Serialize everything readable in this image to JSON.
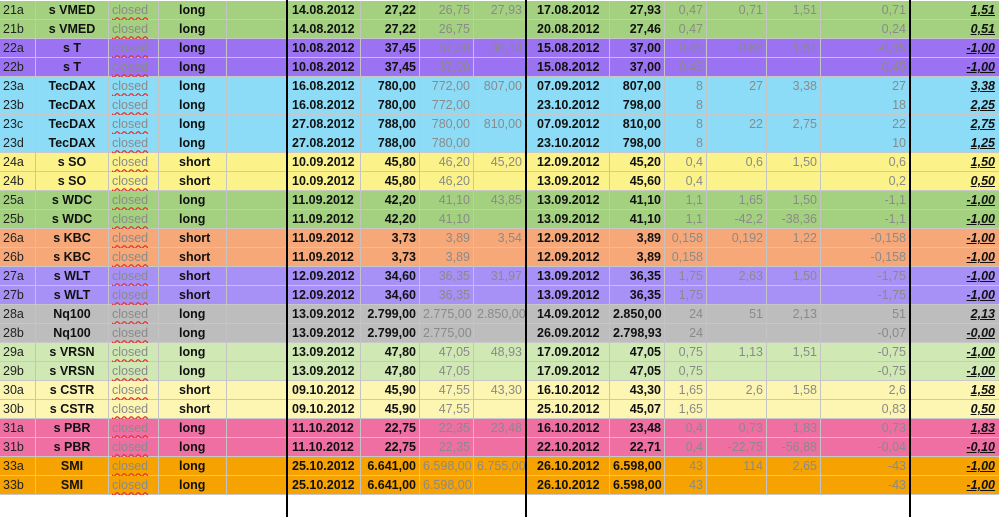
{
  "columns": [
    "id",
    "symbol",
    "status",
    "direction",
    "blank",
    "entry_date",
    "entry_price",
    "stop",
    "target",
    "exit_date",
    "exit_price",
    "risk",
    "reward",
    "crv",
    "result",
    "r_multiple"
  ],
  "rows": [
    {
      "id": "21a",
      "symbol": "s VMED",
      "status": "closed",
      "direction": "long",
      "entry_date": "14.08.2012",
      "entry_price": "27,22",
      "stop": "26,75",
      "target": "27,93",
      "exit_date": "17.08.2012",
      "exit_price": "27,93",
      "risk": "0,47",
      "reward": "0,71",
      "crv": "1,51",
      "result": "0,71",
      "r_multiple": "1,51",
      "color": "#a4d17f"
    },
    {
      "id": "21b",
      "symbol": "s VMED",
      "status": "closed",
      "direction": "long",
      "entry_date": "14.08.2012",
      "entry_price": "27,22",
      "stop": "26,75",
      "target": "",
      "exit_date": "20.08.2012",
      "exit_price": "27,46",
      "risk": "0,47",
      "reward": "",
      "crv": "",
      "result": "0,24",
      "r_multiple": "0,51",
      "color": "#a4d17f"
    },
    {
      "id": "22a",
      "symbol": "s T",
      "status": "closed",
      "direction": "long",
      "entry_date": "10.08.2012",
      "entry_price": "37,45",
      "stop": "37,00",
      "target": "38,13",
      "exit_date": "15.08.2012",
      "exit_price": "37,00",
      "risk": "0,45",
      "reward": "0,68",
      "crv": "1,51",
      "result": "-0,45",
      "r_multiple": "-1,00",
      "color": "#9b72f2"
    },
    {
      "id": "22b",
      "symbol": "s T",
      "status": "closed",
      "direction": "long",
      "entry_date": "10.08.2012",
      "entry_price": "37,45",
      "stop": "37,00",
      "target": "",
      "exit_date": "15.08.2012",
      "exit_price": "37,00",
      "risk": "0,45",
      "reward": "",
      "crv": "",
      "result": "-0,45",
      "r_multiple": "-1,00",
      "color": "#9b72f2"
    },
    {
      "id": "23a",
      "symbol": "TecDAX",
      "status": "closed",
      "direction": "long",
      "entry_date": "16.08.2012",
      "entry_price": "780,00",
      "stop": "772,00",
      "target": "807,00",
      "exit_date": "07.09.2012",
      "exit_price": "807,00",
      "risk": "8",
      "reward": "27",
      "crv": "3,38",
      "result": "27",
      "r_multiple": "3,38",
      "color": "#8ddcf7"
    },
    {
      "id": "23b",
      "symbol": "TecDAX",
      "status": "closed",
      "direction": "long",
      "entry_date": "16.08.2012",
      "entry_price": "780,00",
      "stop": "772,00",
      "target": "",
      "exit_date": "23.10.2012",
      "exit_price": "798,00",
      "risk": "8",
      "reward": "",
      "crv": "",
      "result": "18",
      "r_multiple": "2,25",
      "color": "#8ddcf7"
    },
    {
      "id": "23c",
      "symbol": "TecDAX",
      "status": "closed",
      "direction": "long",
      "entry_date": "27.08.2012",
      "entry_price": "788,00",
      "stop": "780,00",
      "target": "810,00",
      "exit_date": "07.09.2012",
      "exit_price": "810,00",
      "risk": "8",
      "reward": "22",
      "crv": "2,75",
      "result": "22",
      "r_multiple": "2,75",
      "color": "#8ddcf7"
    },
    {
      "id": "23d",
      "symbol": "TecDAX",
      "status": "closed",
      "direction": "long",
      "entry_date": "27.08.2012",
      "entry_price": "788,00",
      "stop": "780,00",
      "target": "",
      "exit_date": "23.10.2012",
      "exit_price": "798,00",
      "risk": "8",
      "reward": "",
      "crv": "",
      "result": "10",
      "r_multiple": "1,25",
      "color": "#8ddcf7"
    },
    {
      "id": "24a",
      "symbol": "s SO",
      "status": "closed",
      "direction": "short",
      "entry_date": "10.09.2012",
      "entry_price": "45,80",
      "stop": "46,20",
      "target": "45,20",
      "exit_date": "12.09.2012",
      "exit_price": "45,20",
      "risk": "0,4",
      "reward": "0,6",
      "crv": "1,50",
      "result": "0,6",
      "r_multiple": "1,50",
      "color": "#fbf28a"
    },
    {
      "id": "24b",
      "symbol": "s SO",
      "status": "closed",
      "direction": "short",
      "entry_date": "10.09.2012",
      "entry_price": "45,80",
      "stop": "46,20",
      "target": "",
      "exit_date": "13.09.2012",
      "exit_price": "45,60",
      "risk": "0,4",
      "reward": "",
      "crv": "",
      "result": "0,2",
      "r_multiple": "0,50",
      "color": "#fbf28a"
    },
    {
      "id": "25a",
      "symbol": "s WDC",
      "status": "closed",
      "direction": "long",
      "entry_date": "11.09.2012",
      "entry_price": "42,20",
      "stop": "41,10",
      "target": "43,85",
      "exit_date": "13.09.2012",
      "exit_price": "41,10",
      "risk": "1,1",
      "reward": "1,65",
      "crv": "1,50",
      "result": "-1,1",
      "r_multiple": "-1,00",
      "color": "#a4d17f"
    },
    {
      "id": "25b",
      "symbol": "s WDC",
      "status": "closed",
      "direction": "long",
      "entry_date": "11.09.2012",
      "entry_price": "42,20",
      "stop": "41,10",
      "target": "",
      "exit_date": "13.09.2012",
      "exit_price": "41,10",
      "risk": "1,1",
      "reward": "-42,2",
      "crv": "-38,36",
      "result": "-1,1",
      "r_multiple": "-1,00",
      "color": "#a4d17f"
    },
    {
      "id": "26a",
      "symbol": "s KBC",
      "status": "closed",
      "direction": "short",
      "entry_date": "11.09.2012",
      "entry_price": "3,73",
      "stop": "3,89",
      "target": "3,54",
      "exit_date": "12.09.2012",
      "exit_price": "3,89",
      "risk": "0,158",
      "reward": "0,192",
      "crv": "1,22",
      "result": "-0,158",
      "r_multiple": "-1,00",
      "color": "#f7a879"
    },
    {
      "id": "26b",
      "symbol": "s KBC",
      "status": "closed",
      "direction": "short",
      "entry_date": "11.09.2012",
      "entry_price": "3,73",
      "stop": "3,89",
      "target": "",
      "exit_date": "12.09.2012",
      "exit_price": "3,89",
      "risk": "0,158",
      "reward": "",
      "crv": "",
      "result": "-0,158",
      "r_multiple": "-1,00",
      "color": "#f7a879"
    },
    {
      "id": "27a",
      "symbol": "s WLT",
      "status": "closed",
      "direction": "short",
      "entry_date": "12.09.2012",
      "entry_price": "34,60",
      "stop": "36,35",
      "target": "31,97",
      "exit_date": "13.09.2012",
      "exit_price": "36,35",
      "risk": "1,75",
      "reward": "2,63",
      "crv": "1,50",
      "result": "-1,75",
      "r_multiple": "-1,00",
      "color": "#a791f7"
    },
    {
      "id": "27b",
      "symbol": "s WLT",
      "status": "closed",
      "direction": "short",
      "entry_date": "12.09.2012",
      "entry_price": "34,60",
      "stop": "36,35",
      "target": "",
      "exit_date": "13.09.2012",
      "exit_price": "36,35",
      "risk": "1,75",
      "reward": "",
      "crv": "",
      "result": "-1,75",
      "r_multiple": "-1,00",
      "color": "#a791f7"
    },
    {
      "id": "28a",
      "symbol": "Nq100",
      "status": "closed",
      "direction": "long",
      "entry_date": "13.09.2012",
      "entry_price": "2.799,00",
      "stop": "2.775,00",
      "target": "2.850,00",
      "exit_date": "14.09.2012",
      "exit_price": "2.850,00",
      "risk": "24",
      "reward": "51",
      "crv": "2,13",
      "result": "51",
      "r_multiple": "2,13",
      "color": "#bdbdbd"
    },
    {
      "id": "28b",
      "symbol": "Nq100",
      "status": "closed",
      "direction": "long",
      "entry_date": "13.09.2012",
      "entry_price": "2.799,00",
      "stop": "2.775,00",
      "target": "",
      "exit_date": "26.09.2012",
      "exit_price": "2.798,93",
      "risk": "24",
      "reward": "",
      "crv": "",
      "result": "-0,07",
      "r_multiple": "-0,00",
      "color": "#bdbdbd"
    },
    {
      "id": "29a",
      "symbol": "s VRSN",
      "status": "closed",
      "direction": "long",
      "entry_date": "13.09.2012",
      "entry_price": "47,80",
      "stop": "47,05",
      "target": "48,93",
      "exit_date": "17.09.2012",
      "exit_price": "47,05",
      "risk": "0,75",
      "reward": "1,13",
      "crv": "1,51",
      "result": "-0,75",
      "r_multiple": "-1,00",
      "color": "#cfe8b4"
    },
    {
      "id": "29b",
      "symbol": "s VRSN",
      "status": "closed",
      "direction": "long",
      "entry_date": "13.09.2012",
      "entry_price": "47,80",
      "stop": "47,05",
      "target": "",
      "exit_date": "17.09.2012",
      "exit_price": "47,05",
      "risk": "0,75",
      "reward": "",
      "crv": "",
      "result": "-0,75",
      "r_multiple": "-1,00",
      "color": "#cfe8b4"
    },
    {
      "id": "30a",
      "symbol": "s CSTR",
      "status": "closed",
      "direction": "short",
      "entry_date": "09.10.2012",
      "entry_price": "45,90",
      "stop": "47,55",
      "target": "43,30",
      "exit_date": "16.10.2012",
      "exit_price": "43,30",
      "risk": "1,65",
      "reward": "2,6",
      "crv": "1,58",
      "result": "2,6",
      "r_multiple": "1,58",
      "color": "#fdf6b2"
    },
    {
      "id": "30b",
      "symbol": "s CSTR",
      "status": "closed",
      "direction": "short",
      "entry_date": "09.10.2012",
      "entry_price": "45,90",
      "stop": "47,55",
      "target": "",
      "exit_date": "25.10.2012",
      "exit_price": "45,07",
      "risk": "1,65",
      "reward": "",
      "crv": "",
      "result": "0,83",
      "r_multiple": "0,50",
      "color": "#fdf6b2"
    },
    {
      "id": "31a",
      "symbol": "s PBR",
      "status": "closed",
      "direction": "long",
      "entry_date": "11.10.2012",
      "entry_price": "22,75",
      "stop": "22,35",
      "target": "23,48",
      "exit_date": "16.10.2012",
      "exit_price": "23,48",
      "risk": "0,4",
      "reward": "0,73",
      "crv": "1,83",
      "result": "0,73",
      "r_multiple": "1,83",
      "color": "#ef6fa3"
    },
    {
      "id": "31b",
      "symbol": "s PBR",
      "status": "closed",
      "direction": "long",
      "entry_date": "11.10.2012",
      "entry_price": "22,75",
      "stop": "22,35",
      "target": "",
      "exit_date": "22.10.2012",
      "exit_price": "22,71",
      "risk": "0,4",
      "reward": "-22,75",
      "crv": "-56,88",
      "result": "-0,04",
      "r_multiple": "-0,10",
      "color": "#ef6fa3"
    },
    {
      "id": "33a",
      "symbol": "SMI",
      "status": "closed",
      "direction": "long",
      "entry_date": "25.10.2012",
      "entry_price": "6.641,00",
      "stop": "6.598,00",
      "target": "6.755,00",
      "exit_date": "26.10.2012",
      "exit_price": "6.598,00",
      "risk": "43",
      "reward": "114",
      "crv": "2,65",
      "result": "-43",
      "r_multiple": "-1,00",
      "color": "#f6a200"
    },
    {
      "id": "33b",
      "symbol": "SMI",
      "status": "closed",
      "direction": "long",
      "entry_date": "25.10.2012",
      "entry_price": "6.641,00",
      "stop": "6.598,00",
      "target": "",
      "exit_date": "26.10.2012",
      "exit_price": "6.598,00",
      "risk": "43",
      "reward": "",
      "crv": "",
      "result": "-43",
      "r_multiple": "-1,00",
      "color": "#f6a200"
    }
  ]
}
